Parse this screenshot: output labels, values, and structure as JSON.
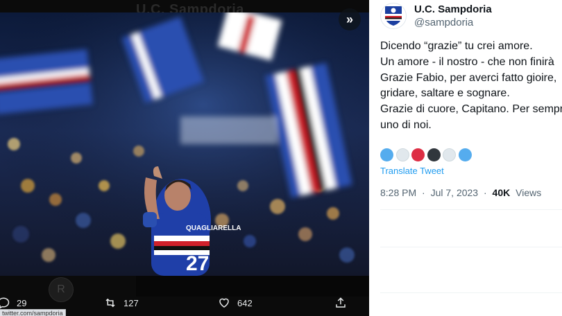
{
  "media": {
    "background_title": "U.C. Sampdoria",
    "expand_icon": "»",
    "player_jersey_name": "QUAGLIARELLA",
    "player_jersey_number": "27",
    "avatar_initial": "R",
    "status_url": "twitter.com/sampdoria"
  },
  "actions": {
    "reply_count": "29",
    "retweet_count": "127",
    "like_count": "642"
  },
  "tweet": {
    "author_name": "U.C. Sampdoria",
    "author_handle": "@sampdoria",
    "lines": [
      "Dicendo “grazie” tu crei amore.",
      "Un amore - il nostro - che non finirà",
      "Grazie Fabio, per averci fatto gioire,",
      "gridare, saltare e sognare.",
      "Grazie di cuore, Capitano. Per sempre",
      "uno di noi."
    ],
    "emoji_colors": [
      "#55acee",
      "#e1e8ed",
      "#dd2e44",
      "#31373d",
      "#e1e8ed",
      "#55acee"
    ],
    "translate_label": "Translate Tweet",
    "time": "8:28 PM",
    "date": "Jul 7, 2023",
    "views_count": "40K",
    "views_label": "Views",
    "separator": "·"
  },
  "colors": {
    "link_blue": "#1d9bf0",
    "sampdoria_blue": "#1b3fa0"
  }
}
